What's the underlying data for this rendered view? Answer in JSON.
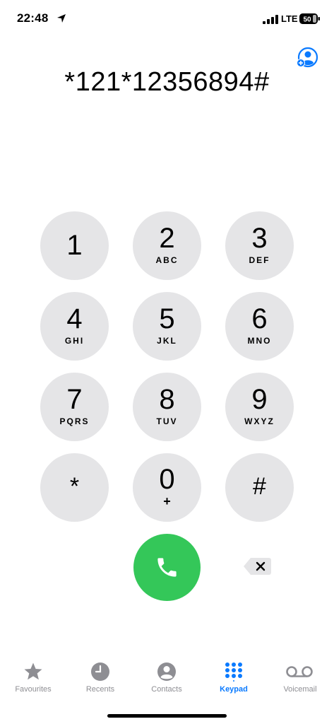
{
  "status": {
    "time": "22:48",
    "network": "LTE",
    "battery": "50"
  },
  "dialer": {
    "number": "*121*12356894#"
  },
  "keypad": {
    "keys": [
      {
        "digit": "1",
        "letters": ""
      },
      {
        "digit": "2",
        "letters": "ABC"
      },
      {
        "digit": "3",
        "letters": "DEF"
      },
      {
        "digit": "4",
        "letters": "GHI"
      },
      {
        "digit": "5",
        "letters": "JKL"
      },
      {
        "digit": "6",
        "letters": "MNO"
      },
      {
        "digit": "7",
        "letters": "PQRS"
      },
      {
        "digit": "8",
        "letters": "TUV"
      },
      {
        "digit": "9",
        "letters": "WXYZ"
      },
      {
        "digit": "*",
        "letters": ""
      },
      {
        "digit": "0",
        "letters": "+"
      },
      {
        "digit": "#",
        "letters": ""
      }
    ]
  },
  "colors": {
    "key_bg": "#e5e5e7",
    "call_green": "#34c759",
    "accent_blue": "#0a7aff",
    "inactive_gray": "#8e8e93"
  },
  "tabs": [
    {
      "label": "Favourites",
      "icon": "star-icon",
      "active": false
    },
    {
      "label": "Recents",
      "icon": "clock-icon",
      "active": false
    },
    {
      "label": "Contacts",
      "icon": "person-circle-icon",
      "active": false
    },
    {
      "label": "Keypad",
      "icon": "keypad-grid-icon",
      "active": true
    },
    {
      "label": "Voicemail",
      "icon": "voicemail-icon",
      "active": false
    }
  ]
}
